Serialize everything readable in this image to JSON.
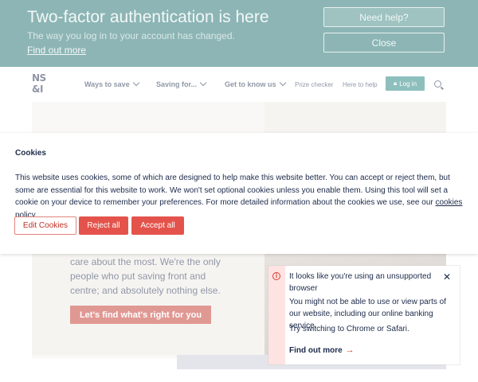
{
  "banner": {
    "title": "Two-factor authentication is here",
    "subtitle": "The way you log in to your account has changed.",
    "link": "Find out more",
    "help_button": "Need help?",
    "close_button": "Close"
  },
  "header": {
    "logo_line1": "NS",
    "logo_line2": "&I",
    "nav": [
      {
        "label": "Ways to save"
      },
      {
        "label": "Saving for..."
      },
      {
        "label": "Get to know us"
      }
    ],
    "prize_checker": "Prize checker",
    "here_to_help": "Here to help",
    "login": "Log in"
  },
  "hero": {
    "text": "care about the most. We're the only people who put saving front and centre; and absolutely nothing else.",
    "cta": "Let's find what's right for you"
  },
  "cookie": {
    "title": "Cookies",
    "body": "This website uses cookies, some of which are designed to help make this website better. You can accept or reject them, but some are essential for this website to work. We won't set optional cookies unless you enable them. Using this tool will set a cookie on your device to remember your preferences. For more detailed information about the cookies we use, see our",
    "policy_link": "cookies policy",
    "edit": "Edit Cookies",
    "reject": "Reject all",
    "accept": "Accept all"
  },
  "toast": {
    "title": "It looks like you're using an unsupported browser",
    "message": "You might not be able to use or view parts of our website, including our online banking service.",
    "tip": "Try switching to Chrome or Safari.",
    "link": "Find out more"
  },
  "colors": {
    "banner": "#1b6b6b",
    "accent_red": "#e4534b",
    "brand_teal": "#1b7f7a",
    "navy": "#1c2a4a"
  }
}
